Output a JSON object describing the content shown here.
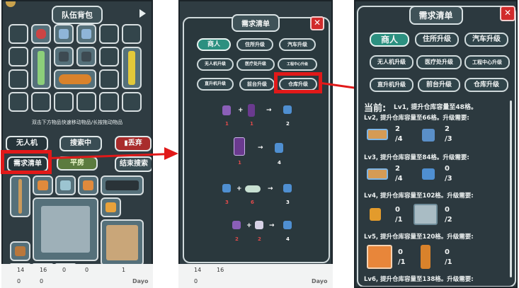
{
  "panel1": {
    "title": "队伍背包",
    "hint": "双击下方物品快速移动物品/长按拖动物品",
    "buttons": {
      "drone": "无人机",
      "searching": "搜索中",
      "discard": "丢弃",
      "demand": "需求清单",
      "location": "平房",
      "end_search": "结束搜索"
    }
  },
  "panel2": {
    "title": "需求清单",
    "tabs": [
      "商人",
      "住所升级",
      "汽车升级",
      "无人机升级",
      "医疗处升级",
      "工程中心升级",
      "直升机升级",
      "前台升级",
      "仓库升级"
    ],
    "recipes": [
      {
        "in1": "1",
        "in2": "1",
        "out": "2"
      },
      {
        "in1": "1",
        "out": "4"
      },
      {
        "in1": "3",
        "in2": "6",
        "out": "3"
      },
      {
        "in1": "2",
        "in2": "2",
        "out": "4"
      }
    ]
  },
  "panel3": {
    "title": "需求清单",
    "tabs": [
      "商人",
      "住所升级",
      "汽车升级",
      "无人机升级",
      "医疗处升级",
      "工程中心升级",
      "直升机升级",
      "前台升级",
      "仓库升级"
    ],
    "current_label": "当前:",
    "current_text": "Lv1, 提升仓库容量至48格。",
    "levels": [
      {
        "text": "Lv2, 提升仓库容量至66格。升级需要:",
        "mats": [
          {
            "have": "2",
            "need": "/4"
          },
          {
            "have": "2",
            "need": "/3"
          }
        ]
      },
      {
        "text": "Lv3, 提升仓库容量至84格。升级需要:",
        "mats": [
          {
            "have": "2",
            "need": "/4"
          },
          {
            "have": "0",
            "need": "/3"
          }
        ]
      },
      {
        "text": "Lv4, 提升仓库容量至102格。升级需要:",
        "mats": [
          {
            "have": "0",
            "need": "/1"
          },
          {
            "have": "0",
            "need": "/2"
          }
        ]
      },
      {
        "text": "Lv5, 提升仓库容量至120格。升级需要:",
        "mats": [
          {
            "have": "0",
            "need": "/1"
          },
          {
            "have": "0",
            "need": "/1"
          }
        ]
      },
      {
        "text": "Lv6, 提升仓库容量至138格。升级需要:"
      }
    ]
  },
  "resources": {
    "row1": [
      "14",
      "16",
      "0",
      "0",
      "0",
      "0",
      "1",
      "0"
    ],
    "row2": [
      "0",
      "0",
      "0",
      "0"
    ],
    "brand": "Dayo"
  },
  "colors": {
    "panel": "#2f3c42",
    "accent_red": "#e11919",
    "teal": "#2c9080"
  }
}
